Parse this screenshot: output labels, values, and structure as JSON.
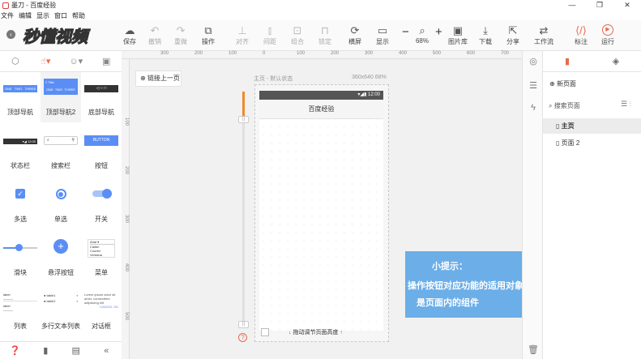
{
  "window": {
    "title": "墨刀 - 百度经验",
    "controls": [
      "—",
      "❐",
      "✕"
    ]
  },
  "menu": [
    "文件",
    "编辑",
    "显示",
    "窗口",
    "帮助"
  ],
  "brand": {
    "watermark": "秒懂视频"
  },
  "toolbar": {
    "items": [
      {
        "icon": "cloud-upload-icon",
        "label": "保存",
        "dim": false
      },
      {
        "icon": "undo-icon",
        "label": "撤销",
        "dim": true
      },
      {
        "icon": "redo-icon",
        "label": "重做",
        "dim": true
      },
      {
        "icon": "action-icon",
        "label": "操作",
        "dim": false
      },
      {
        "icon": "align-icon",
        "label": "对齐",
        "dim": true
      },
      {
        "icon": "distribute-icon",
        "label": "间距",
        "dim": true
      },
      {
        "icon": "group-icon",
        "label": "组合",
        "dim": true
      },
      {
        "icon": "lock-icon",
        "label": "锁定",
        "dim": true
      },
      {
        "icon": "rotate-icon",
        "label": "横屏",
        "dim": false
      },
      {
        "icon": "display-icon",
        "label": "显示",
        "dim": false
      },
      {
        "icon": "image-library-icon",
        "label": "图片库",
        "dim": false
      },
      {
        "icon": "download-icon",
        "label": "下载",
        "dim": false
      },
      {
        "icon": "share-icon",
        "label": "分享",
        "dim": false
      },
      {
        "icon": "workflow-icon",
        "label": "工作流",
        "dim": false
      },
      {
        "icon": "annotate-icon",
        "label": "标注",
        "dim": false
      },
      {
        "icon": "run-icon",
        "label": "运行",
        "dim": false
      }
    ],
    "zoom": "68%"
  },
  "components": [
    {
      "label": "顶部导航",
      "thumb": "topnav"
    },
    {
      "label": "顶部导航2",
      "thumb": "topnav2"
    },
    {
      "label": "底部导航",
      "thumb": "bottomnav"
    },
    {
      "label": "状态栏",
      "thumb": "statusbar"
    },
    {
      "label": "搜索栏",
      "thumb": "searchbar"
    },
    {
      "label": "按钮",
      "thumb": "button"
    },
    {
      "label": "多选",
      "thumb": "checkbox"
    },
    {
      "label": "单选",
      "thumb": "radio"
    },
    {
      "label": "开关",
      "thumb": "toggle"
    },
    {
      "label": "滑块",
      "thumb": "slider"
    },
    {
      "label": "悬浮按钮",
      "thumb": "fab"
    },
    {
      "label": "菜单",
      "thumb": "menu"
    },
    {
      "label": "列表",
      "thumb": "list"
    },
    {
      "label": "多行文本列表",
      "thumb": "multiline"
    },
    {
      "label": "对话框",
      "thumb": "dialog"
    }
  ],
  "thumb_text": {
    "tab": "TAB",
    "three": "THREE",
    "title": "Title",
    "one": "ONE",
    "two": "TWO",
    "status_time": "12:00",
    "button": "BUTTON",
    "menu_items": [
      "Arial",
      "Calibri",
      "Courier",
      "Verdana"
    ],
    "list_items": [
      "label",
      "label"
    ],
    "table_items": [
      "table1",
      "table2"
    ],
    "dialog_body": "Lorem ipsum dolor sit amet, consectetur adipiscing elit",
    "dialog_btns": "CANCEL OK"
  },
  "ruler": {
    "top": [
      "300",
      "200",
      "100",
      "0",
      "100",
      "200",
      "300",
      "400",
      "500",
      "600",
      "700"
    ],
    "left": [
      "100",
      "200",
      "300",
      "400",
      "500",
      "600"
    ]
  },
  "canvas": {
    "link_button": "链接上一页",
    "page_label": "主页 - 默认状态",
    "page_size": "360x640 68%",
    "status_time": "12:00",
    "nav_title": "百度经验",
    "drag_hint": "拖动调节页面高度",
    "slider_knob_top": "||",
    "slider_knob_bottom": "||",
    "help": "?"
  },
  "hint": {
    "title": "小提示：",
    "line1": "操作按钮对应功能的适用对象",
    "line2": "是页面内的组件"
  },
  "right_panel": {
    "new_page": "新页面",
    "search_placeholder": "搜索页面",
    "pages": [
      {
        "name": "主页",
        "active": true
      },
      {
        "name": "页面 2",
        "active": false
      }
    ]
  },
  "colors": {
    "accent": "#e86a4d",
    "hint_bg": "#6baee8",
    "thumb_blue": "#5b8ef5"
  }
}
